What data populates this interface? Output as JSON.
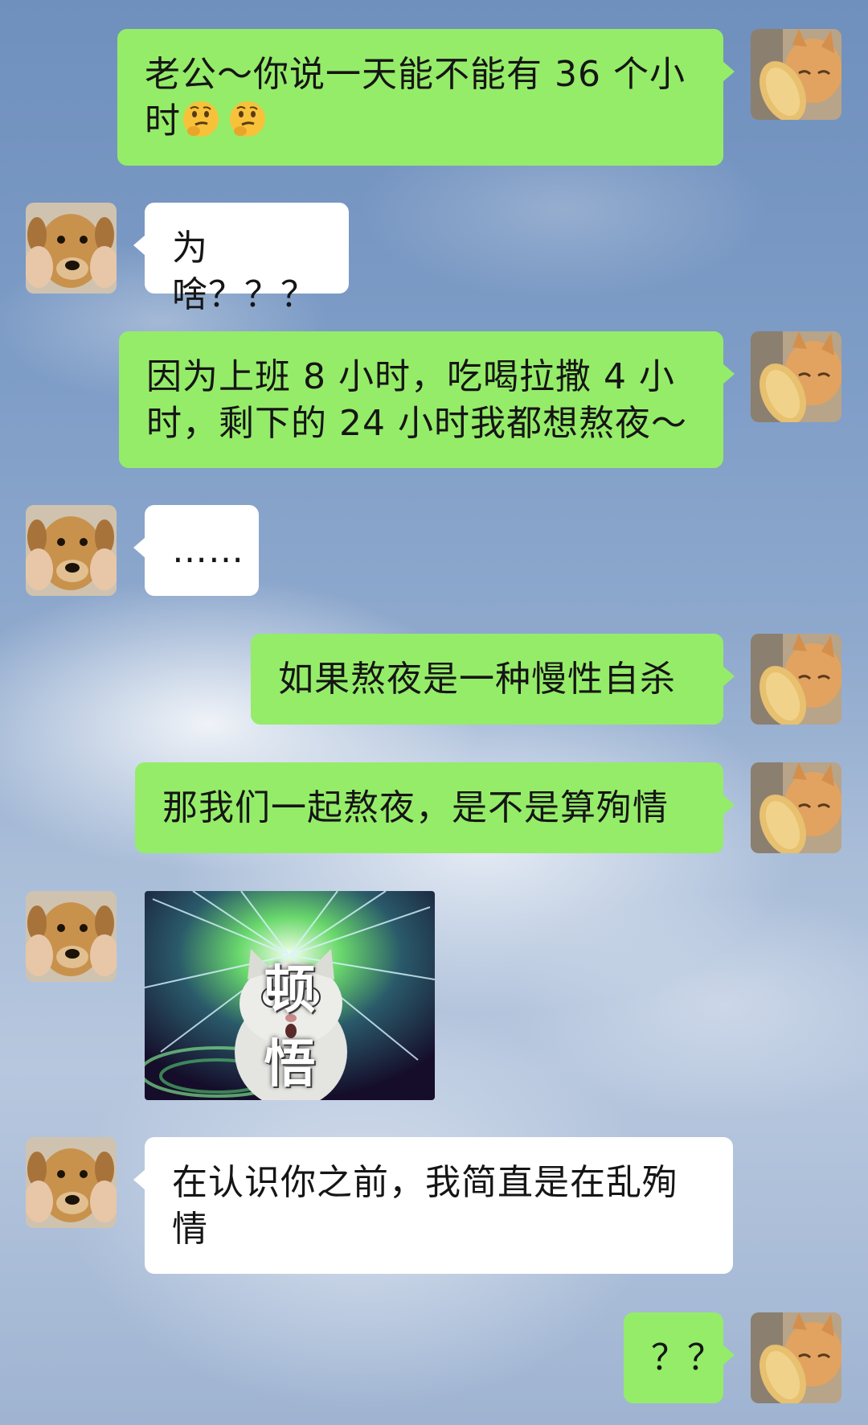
{
  "chat": {
    "messages": [
      {
        "sender": "me",
        "text": "老公～你说一天能不能有 36 个小时",
        "emojis": [
          "thinking-face",
          "thinking-face"
        ]
      },
      {
        "sender": "other",
        "text": "为啥？？？"
      },
      {
        "sender": "me",
        "text": "因为上班 8 小时，吃喝拉撒 4 小时，剩下的 24 小时我都想熬夜～"
      },
      {
        "sender": "other",
        "text": "……"
      },
      {
        "sender": "me",
        "text": "如果熬夜是一种慢性自杀"
      },
      {
        "sender": "me",
        "text": "那我们一起熬夜，是不是算殉情"
      },
      {
        "sender": "other",
        "type": "sticker",
        "caption": "顿 悟",
        "icon": "surprised-cat-sticker"
      },
      {
        "sender": "other",
        "text": "在认识你之前，我简直是在乱殉情"
      },
      {
        "sender": "me",
        "text": "？？"
      }
    ]
  },
  "avatars": {
    "me": "orange-cat-avatar",
    "other": "puppy-dog-avatar"
  },
  "colors": {
    "sent_bubble": "#95ec69",
    "received_bubble": "#ffffff",
    "sky": "#7d9cc6"
  }
}
